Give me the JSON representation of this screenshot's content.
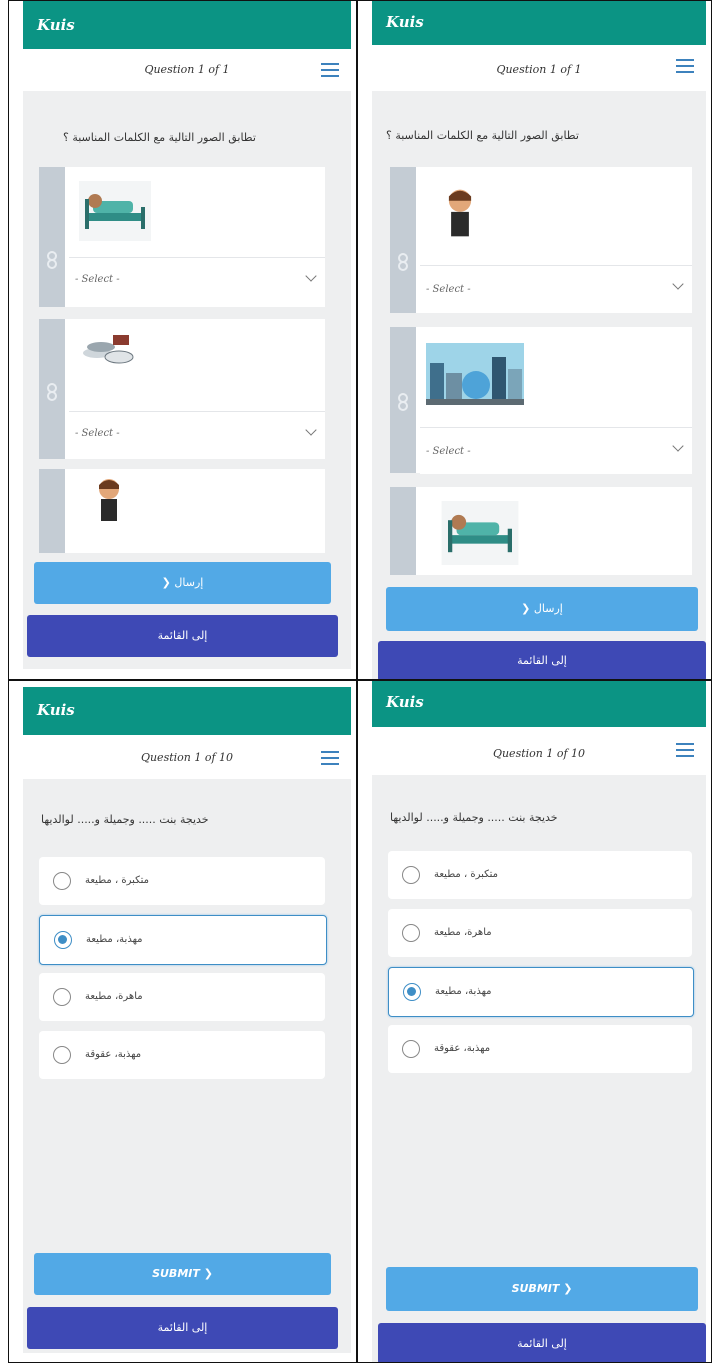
{
  "app_title": "Kuis",
  "match_question": "تطابق الصور التالية مع الكلمات المناسبة ؟",
  "select_placeholder": "- Select -",
  "submit_ar": "إرسال",
  "submit_en": "SUBMIT",
  "back_label": "إلى القائمة",
  "panels": [
    {
      "counter": "Question 1 of 1"
    },
    {
      "counter": "Question 1 of 1"
    },
    {
      "counter": "Question 1 of 10"
    },
    {
      "counter": "Question 1 of 10"
    }
  ],
  "mcq_question": "خديجة بنت ..... وجميلة و..... لوالديها",
  "mcq_options_a": [
    "متكبرة ، مطيعة",
    "مهذبة، مطيعة",
    "ماهرة، مطيعة",
    "مهذبة، عقوقة"
  ],
  "mcq_options_b": [
    "متكبرة ، مطيعة",
    "ماهرة، مطيعة",
    "مهذبة، مطيعة",
    "مهذبة، عقوقة"
  ],
  "selected_a": 1,
  "selected_b": 2,
  "icons": {
    "menu": "hamburger-menu-icon",
    "drag": "drag-handle-icon",
    "chevron": "chevron-down-icon",
    "submit_arrow": "chevron-right-icon"
  },
  "colors": {
    "appbar": "#0b9484",
    "submit": "#52a9e6",
    "back": "#3e49b5",
    "radio": "#3e8ec6"
  }
}
